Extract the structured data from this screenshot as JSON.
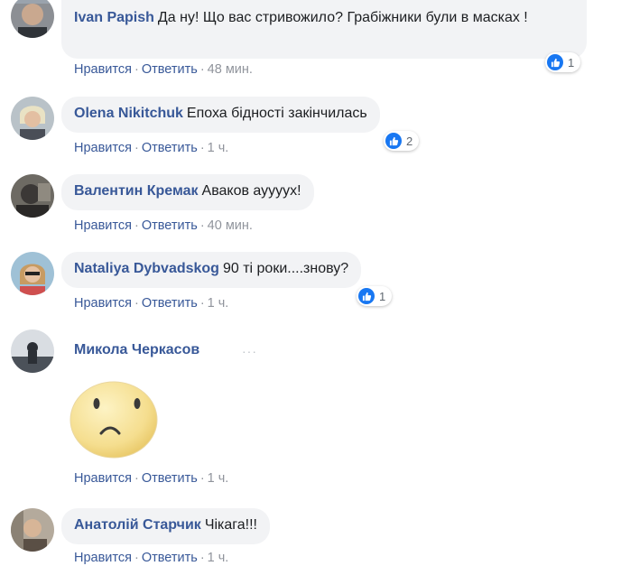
{
  "actions": {
    "like": "Нравится",
    "reply": "Ответить",
    "sep": "·"
  },
  "comments": [
    {
      "author": "Ivan Papish",
      "text": "Да ну! Що вас стривожило? Грабіжники були в масках !",
      "time": "48 мин.",
      "likes": "1"
    },
    {
      "author": "Olena Nikitchuk",
      "text": "Епоха бідності закінчилась",
      "time": "1 ч.",
      "likes": "2"
    },
    {
      "author": "Валентин Кремак",
      "text": "Аваков ауууух!",
      "time": "40 мин.",
      "likes": ""
    },
    {
      "author": "Nataliya Dybvadskog",
      "text": "90 ті роки....знову?",
      "time": "1 ч.",
      "likes": "1"
    },
    {
      "author": "Микола Черкасов",
      "text": "",
      "time": "1 ч.",
      "likes": "",
      "sticker": "sad-face-sticker",
      "more": "···"
    },
    {
      "author": "Анатолій Старчик",
      "text": "Чікага!!!",
      "time": "1 ч.",
      "likes": ""
    }
  ],
  "colors": {
    "link": "#385898",
    "meta": "#90949c",
    "bubble": "#f2f3f5",
    "like_blue": "#1877f2",
    "sticker_yellow": "#f8e39a"
  }
}
